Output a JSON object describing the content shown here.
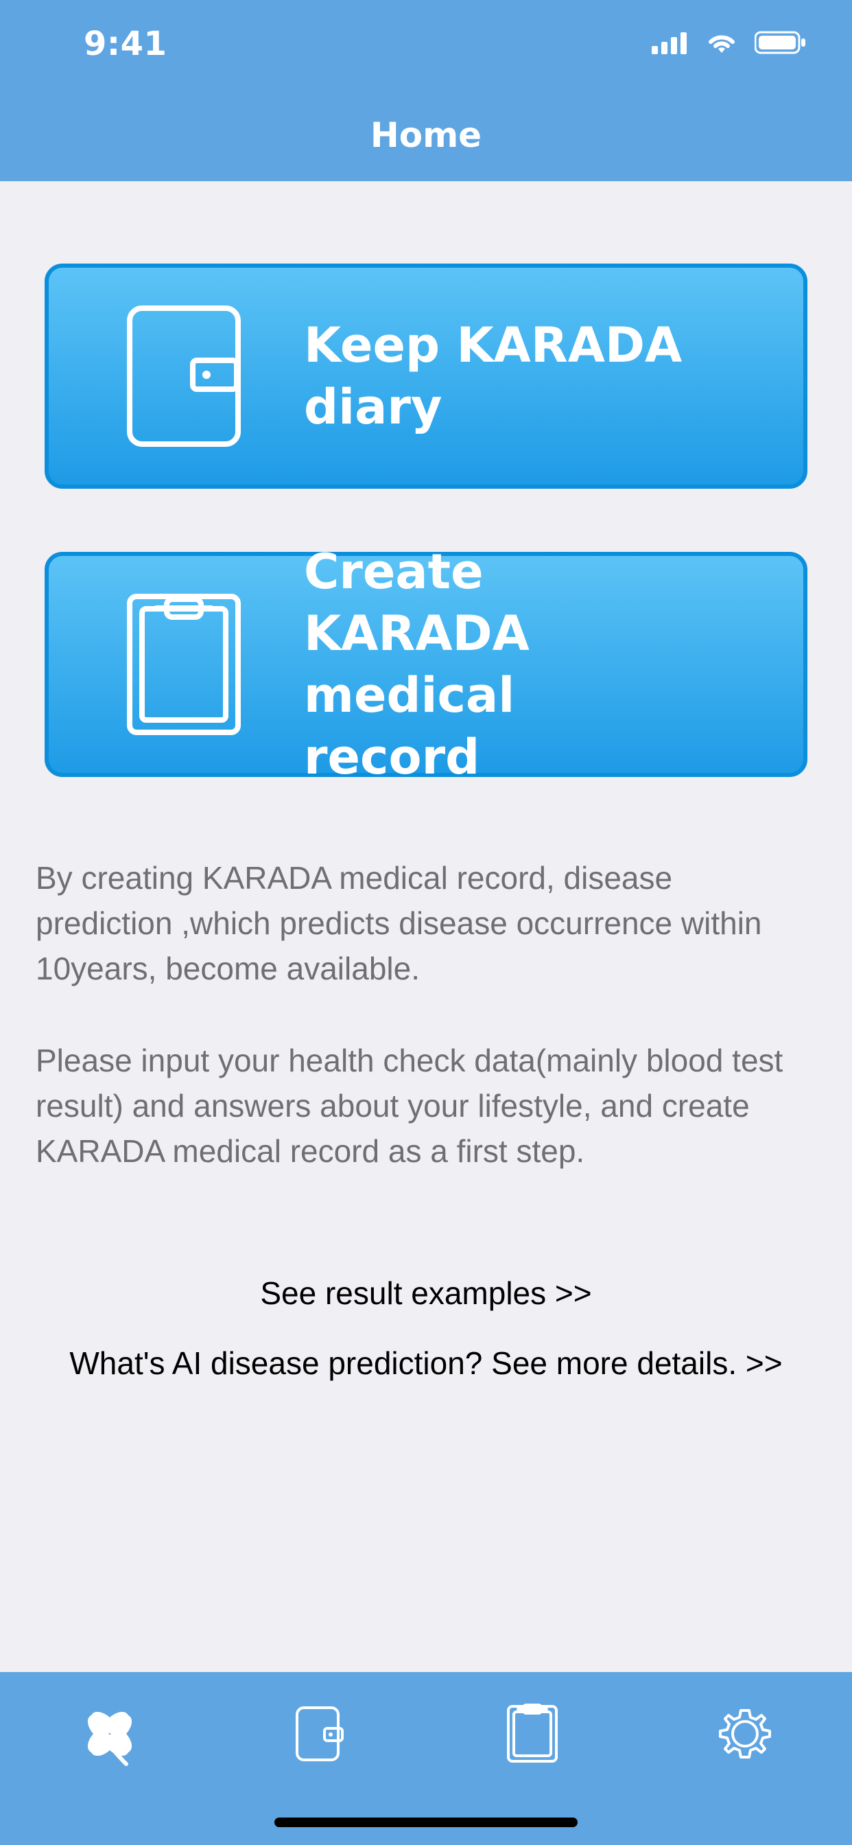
{
  "status": {
    "time": "9:41"
  },
  "header": {
    "title": "Home"
  },
  "buttons": {
    "diary": {
      "label": "Keep KARADA diary",
      "icon": "diary-icon"
    },
    "record": {
      "label": "Create KARADA medical record",
      "icon": "clipboard-icon"
    }
  },
  "description": {
    "p1": "By creating KARADA medical record, disease prediction ,which predicts disease occurrence within 10years, become available.",
    "p2": "Please input your health check data(mainly blood test result) and answers about your lifestyle, and create KARADA medical record as a first step."
  },
  "links": {
    "examples": "See result examples >>",
    "details": "What's AI disease prediction? See more details. >>"
  },
  "tabs": [
    {
      "name": "home",
      "icon": "clover-icon"
    },
    {
      "name": "diary",
      "icon": "diary-icon"
    },
    {
      "name": "record",
      "icon": "clipboard-icon"
    },
    {
      "name": "settings",
      "icon": "gear-icon"
    }
  ],
  "colors": {
    "header": "#5FA5E2",
    "background": "#EFEFF4",
    "button_top": "#5CC3F6",
    "button_bottom": "#1E9BE6",
    "button_border": "#0B8EDB",
    "tabbar": "#5FA5E2"
  }
}
